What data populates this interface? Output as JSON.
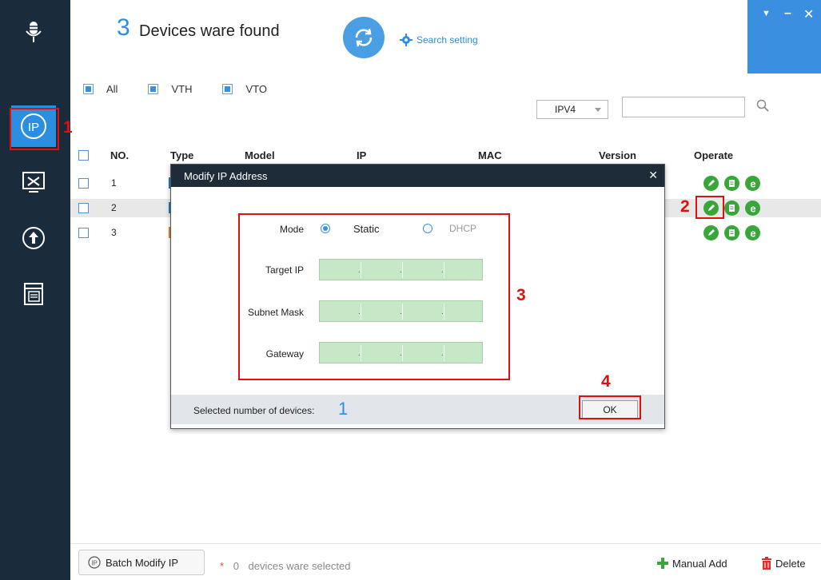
{
  "header": {
    "device_count": "3",
    "found_text": "Devices ware found",
    "search_setting": "Search setting",
    "win_ctrl": [
      "▼",
      "–",
      "✕"
    ]
  },
  "filters": {
    "items": [
      {
        "label": "All"
      },
      {
        "label": "VTH"
      },
      {
        "label": "VTO"
      }
    ],
    "ip_version": "IPV4",
    "search_value": ""
  },
  "table": {
    "columns": [
      "NO.",
      "Type",
      "Model",
      "IP",
      "MAC",
      "Version",
      "Operate"
    ],
    "rows": [
      {
        "no": "1",
        "type_color": "#1f77d0"
      },
      {
        "no": "2",
        "type_color": "#1f77d0"
      },
      {
        "no": "3",
        "type_color": "#f08020"
      }
    ]
  },
  "dialog": {
    "title": "Modify IP Address",
    "close": "✕",
    "mode_label": "Mode",
    "mode_static": "Static",
    "mode_dhcp": "DHCP",
    "target_ip_label": "Target IP",
    "subnet_mask_label": "Subnet Mask",
    "gateway_label": "Gateway",
    "selected_label": "Selected number of devices:",
    "selected_count": "1",
    "ok_label": "OK"
  },
  "bottom": {
    "batch_label": "Batch Modify IP",
    "star": "*",
    "selected_count": "0",
    "selected_text": "devices ware selected",
    "manual_add": "Manual Add",
    "delete": "Delete"
  },
  "annotations": [
    "1",
    "2",
    "3",
    "4"
  ],
  "colors": {
    "accent": "#2b8ee0",
    "sidebar": "#1a2b3c",
    "annotation": "#e01010",
    "ip_field": "#c7e8c7",
    "operate_green": "#3aa63a"
  }
}
